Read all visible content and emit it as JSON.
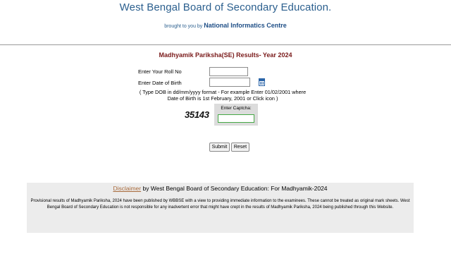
{
  "header": {
    "title": "West Bengal Board of Secondary Education.",
    "brought_prefix": "brought to you by ",
    "brought_name": "National Informatics Centre"
  },
  "form": {
    "heading": "Madhyamik Pariksha(SE) Results- Year 2024",
    "roll_label": "Enter Your Roll No",
    "roll_value": "",
    "dob_label": "Enter Date of Birth",
    "dob_value": "",
    "dob_hint_line1": "( Type DOB in dd/mm/yyyy format - For example Enter 01/02/2001 where",
    "dob_hint_line2": "Date of Birth is 1st February, 2001 or Click icon   )",
    "captcha_code": "35143",
    "captcha_label": "Enter Captcha:",
    "captcha_value": "",
    "submit_label": "Submit",
    "reset_label": "Reset"
  },
  "footer": {
    "disclaimer_link": "Disclaimer",
    "disclaimer_rest": " by West Bengal Board of Secondary Education: For Madhyamik-2024",
    "text": "Provisional results of Madhyamik Pariksha, 2024 have been published by WBBSE with a view to providing immediate information to the examinees. These cannot be treated as original mark sheets. West Bengal Board of Secondary Education is not responsible for any inadvertent error that might have crept in the results of Madhyamik Pariksha, 2024 being published through this Website."
  }
}
